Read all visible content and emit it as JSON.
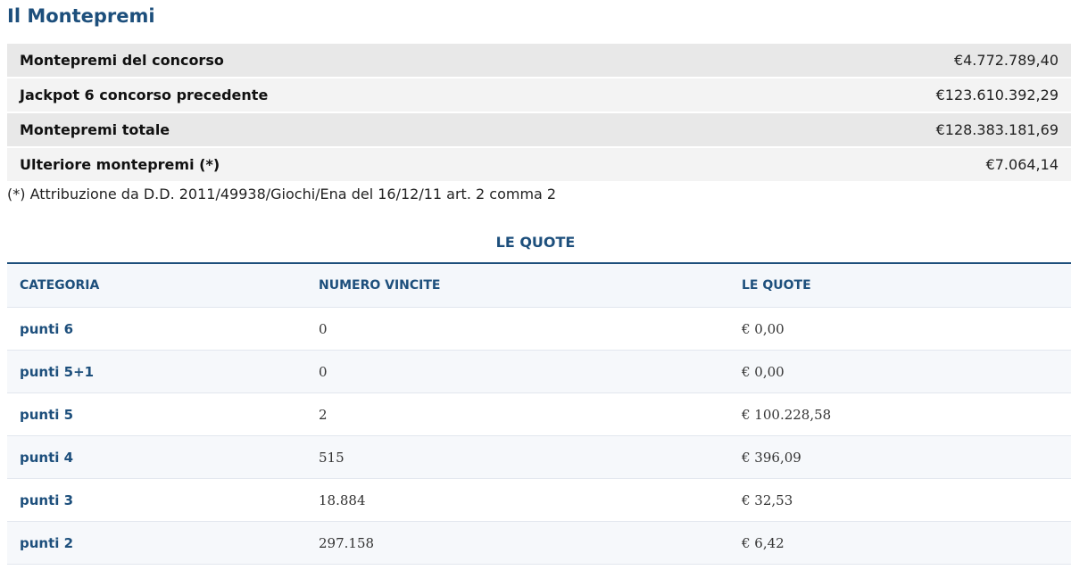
{
  "title": "Il Montepremi",
  "summary": [
    {
      "label": "Montepremi del concorso",
      "value": "€4.772.789,40"
    },
    {
      "label": "Jackpot 6 concorso precedente",
      "value": "€123.610.392,29"
    },
    {
      "label": "Montepremi totale",
      "value": "€128.383.181,69"
    },
    {
      "label": "Ulteriore montepremi (*)",
      "value": "€7.064,14"
    }
  ],
  "footnote": "(*) Attribuzione da D.D. 2011/49938/Giochi/Ena del 16/12/11 art. 2 comma 2",
  "quotes": {
    "title": "LE QUOTE",
    "headers": [
      "CATEGORIA",
      "NUMERO VINCITE",
      "LE QUOTE"
    ],
    "rows": [
      {
        "categoria": "punti 6",
        "vincite": "0",
        "quota": "€ 0,00"
      },
      {
        "categoria": "punti 5+1",
        "vincite": "0",
        "quota": "€ 0,00"
      },
      {
        "categoria": "punti 5",
        "vincite": "2",
        "quota": "€ 100.228,58"
      },
      {
        "categoria": "punti 4",
        "vincite": "515",
        "quota": "€ 396,09"
      },
      {
        "categoria": "punti 3",
        "vincite": "18.884",
        "quota": "€ 32,53"
      },
      {
        "categoria": "punti 2",
        "vincite": "297.158",
        "quota": "€ 6,42"
      }
    ]
  }
}
